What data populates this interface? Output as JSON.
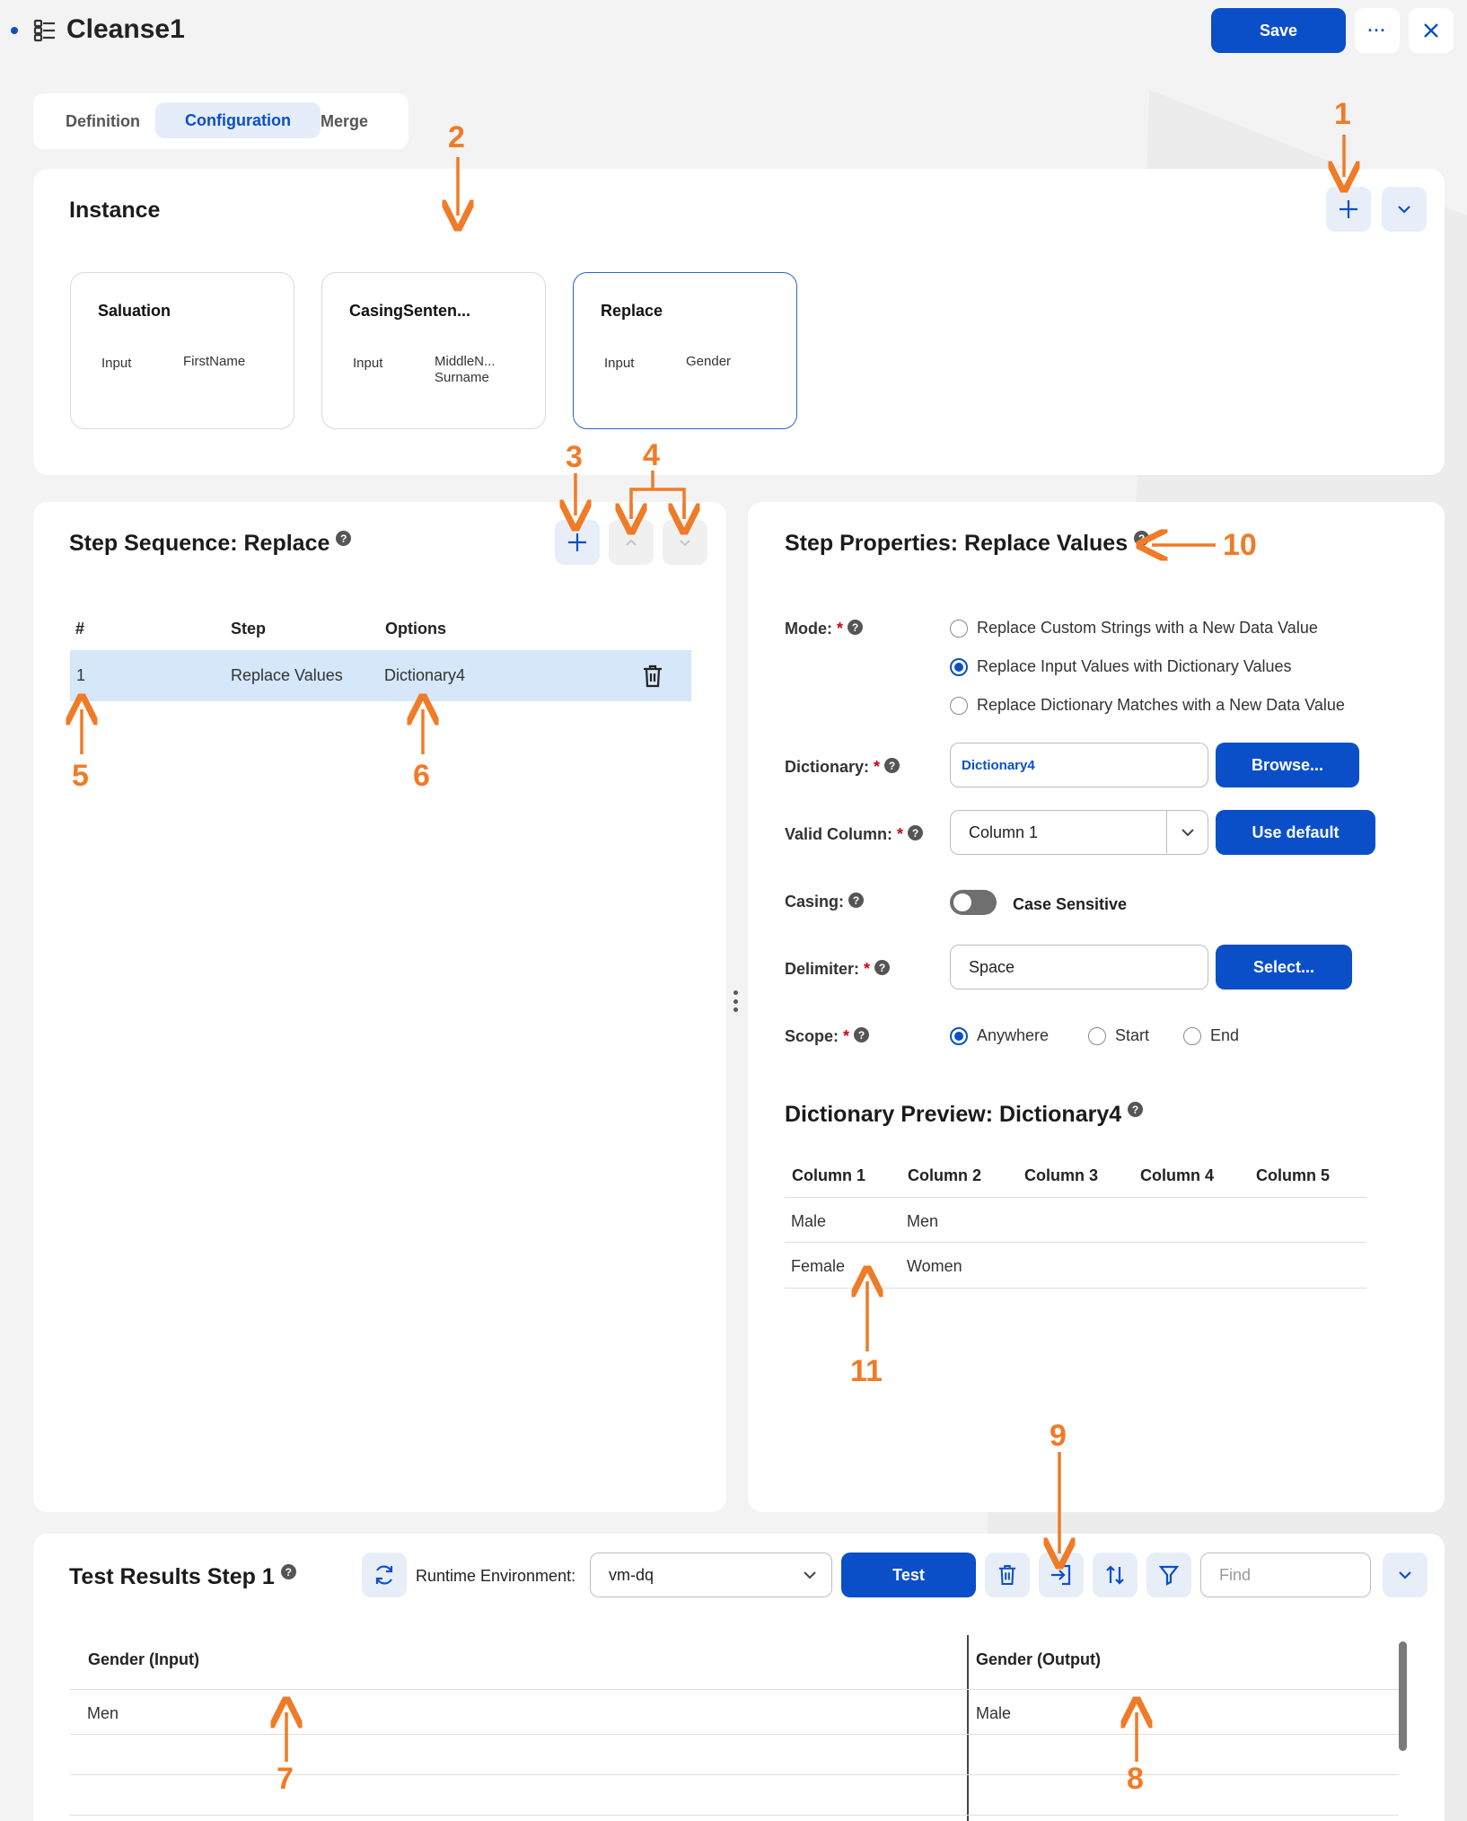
{
  "header": {
    "title": "Cleanse1",
    "save_label": "Save"
  },
  "tabs": [
    {
      "label": "Definition"
    },
    {
      "label": "Configuration"
    },
    {
      "label": "Merge"
    }
  ],
  "instance": {
    "title": "Instance",
    "cards": [
      {
        "title": "Saluation",
        "key": "Input",
        "value": "FirstName"
      },
      {
        "title": "CasingSenten...",
        "key": "Input",
        "value": "MiddleN...\nSurname"
      },
      {
        "title": "Replace",
        "key": "Input",
        "value": "Gender"
      }
    ]
  },
  "step_sequence": {
    "title": "Step Sequence: Replace",
    "columns": [
      "#",
      "Step",
      "Options"
    ],
    "rows": [
      {
        "num": "1",
        "step": "Replace Values",
        "options": "Dictionary4"
      }
    ]
  },
  "step_properties": {
    "title": "Step Properties: Replace Values",
    "mode_label": "Mode:",
    "mode_options": [
      "Replace Custom Strings with a New Data Value",
      "Replace Input Values with Dictionary Values",
      "Replace Dictionary Matches with a New Data Value"
    ],
    "mode_selected_index": 1,
    "dictionary_label": "Dictionary:",
    "dictionary_value": "Dictionary4",
    "browse_label": "Browse...",
    "valid_column_label": "Valid Column:",
    "valid_column_value": "Column 1",
    "use_default_label": "Use default",
    "casing_label": "Casing:",
    "casing_toggle_label": "Case Sensitive",
    "casing_on": false,
    "delimiter_label": "Delimiter:",
    "delimiter_value": "Space",
    "select_label": "Select...",
    "scope_label": "Scope:",
    "scope_options": [
      "Anywhere",
      "Start",
      "End"
    ],
    "scope_selected_index": 0
  },
  "dictionary_preview": {
    "title": "Dictionary Preview: Dictionary4",
    "columns": [
      "Column 1",
      "Column 2",
      "Column 3",
      "Column 4",
      "Column 5"
    ],
    "rows": [
      [
        "Male",
        "Men"
      ],
      [
        "Female",
        "Women"
      ]
    ]
  },
  "test_results": {
    "title": "Test Results Step 1",
    "runtime_label": "Runtime Environment:",
    "runtime_value": "vm-dq",
    "test_label": "Test",
    "find_placeholder": "Find",
    "columns": [
      "Gender (Input)",
      "Gender (Output)"
    ],
    "rows": [
      [
        "Men",
        "Male"
      ]
    ]
  },
  "callouts": [
    "1",
    "2",
    "3",
    "4",
    "5",
    "6",
    "7",
    "8",
    "9",
    "10",
    "11"
  ],
  "colors": {
    "accent": "#0b4fc8",
    "callout": "#f07b27",
    "selected_row": "#d5e7f8"
  }
}
